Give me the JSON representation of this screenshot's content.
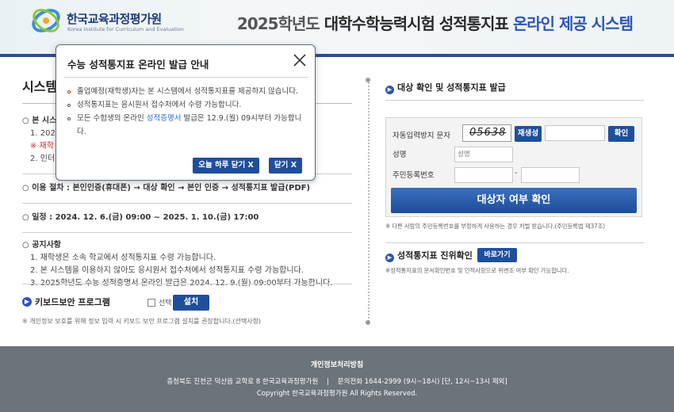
{
  "colors": {
    "accent": "#2b56b5",
    "button": "#1f4f9c",
    "warning": "#d7281f",
    "footer_bg": "#6c7379"
  },
  "header": {
    "logo_title": "한국교육과정평가원",
    "logo_sub": "Korea Institute for Curriculum and Evaluation",
    "title_year": "2025학년도 ",
    "title_main": "대학수학능력시험 성적통지표 ",
    "title_accent": "온라인 제공 시스템"
  },
  "left": {
    "section_title": "시스템",
    "s1_head": "○ 본 시스",
    "s1_item1": "1. 202",
    "s1_item_red": "※ 재학",
    "s1_item2": "2. 인터",
    "s2_head": "○ 이용 절차 : 본인인증(휴대폰) → 대상 확인 → 본인 인증 → 성적통지표 발급(PDF)",
    "s3_label": "○ 일정 : ",
    "s3_value": "2024. 12. 6.(금) 09:00 ~ 2025. 1. 10.(금) 17:00",
    "s4_head": "○ 공지사항",
    "s4_items": [
      "1. 재학생은 소속 학교에서 성적통지표 수령 가능합니다.",
      "2. 본 시스템을 이용하지 않아도 응시원서 접수처에서 성적통지표 수령 가능합니다.",
      "3. 2025학년도 수능 성적증명서 온라인 발급은 2024. 12. 9.(월) 09:00부터 가능합니다."
    ],
    "keyboard_label": "키보드보안 프로그램",
    "keyboard_check_label": "선택",
    "keyboard_install": "설치",
    "keyboard_note": "※ 개인정보 보호를 위해 정보 입력 시 키보드 보안 프로그램 설치를 권장합니다.(선택사항)"
  },
  "right": {
    "title": "대상 확인 및 성적통지표 발급",
    "captcha_label": "자동입력방지 문자",
    "captcha_text": "05638",
    "refresh": "재생성",
    "confirm": "확인",
    "name_label": "성명",
    "name_placeholder": "성명",
    "rrn_label": "주민등록번호",
    "rrn_dash": "-",
    "submit": "대상자 여부 확인",
    "note": "※ 다른 사람의 주민등록번호를 부정하게 사용하는 경우 처벌 받습니다.(주민등록법 제37조)",
    "auth_title": "성적통지표 진위확인",
    "auth_button": "바로가기",
    "auth_note": "※성적통지표의 문서확인번호 및 인적사항으로 위변조 여부 확인 가능합니다."
  },
  "footer": {
    "privacy": "개인정보처리방침",
    "address": "충청북도 진천군 덕산읍 교학로 8 한국교육과정평가원    |    문의전화 1644-2999 (9시~18시) [단, 12시~13시 제외]",
    "copyright": "Copyright 한국교육과정평가원 All Rights Reserved."
  },
  "modal": {
    "title": "수능 성적통지표 온라인 발급 안내",
    "item1": "졸업예정(재학생)자는 본 시스템에서 성적통지표를 제공하지 않습니다.",
    "item2": "성적통지표는 응시원서 접수처에서 수령 가능합니다.",
    "item3_pre": "모든 수험생의 온라인 ",
    "item3_link": "성적증명서",
    "item3_post": " 발급은 12.9.(월) 09시부터 가능합니다.",
    "btn_today": "오늘 하루 닫기 X",
    "btn_close": "닫기 X"
  }
}
